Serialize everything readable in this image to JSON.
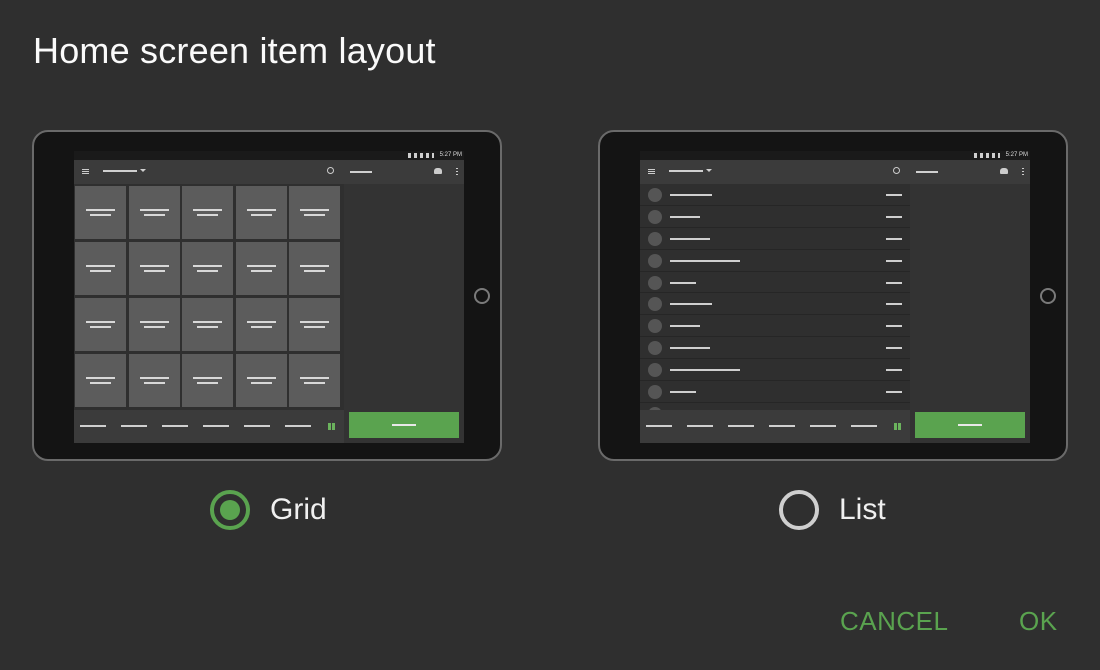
{
  "dialog": {
    "title": "Home screen item layout",
    "accent_color": "#5aa34f",
    "background_color": "#2f2f2f"
  },
  "preview": {
    "status_time": "5:27 PM"
  },
  "options": [
    {
      "label": "Grid",
      "selected": true
    },
    {
      "label": "List",
      "selected": false
    }
  ],
  "actions": {
    "cancel_label": "CANCEL",
    "ok_label": "OK"
  }
}
